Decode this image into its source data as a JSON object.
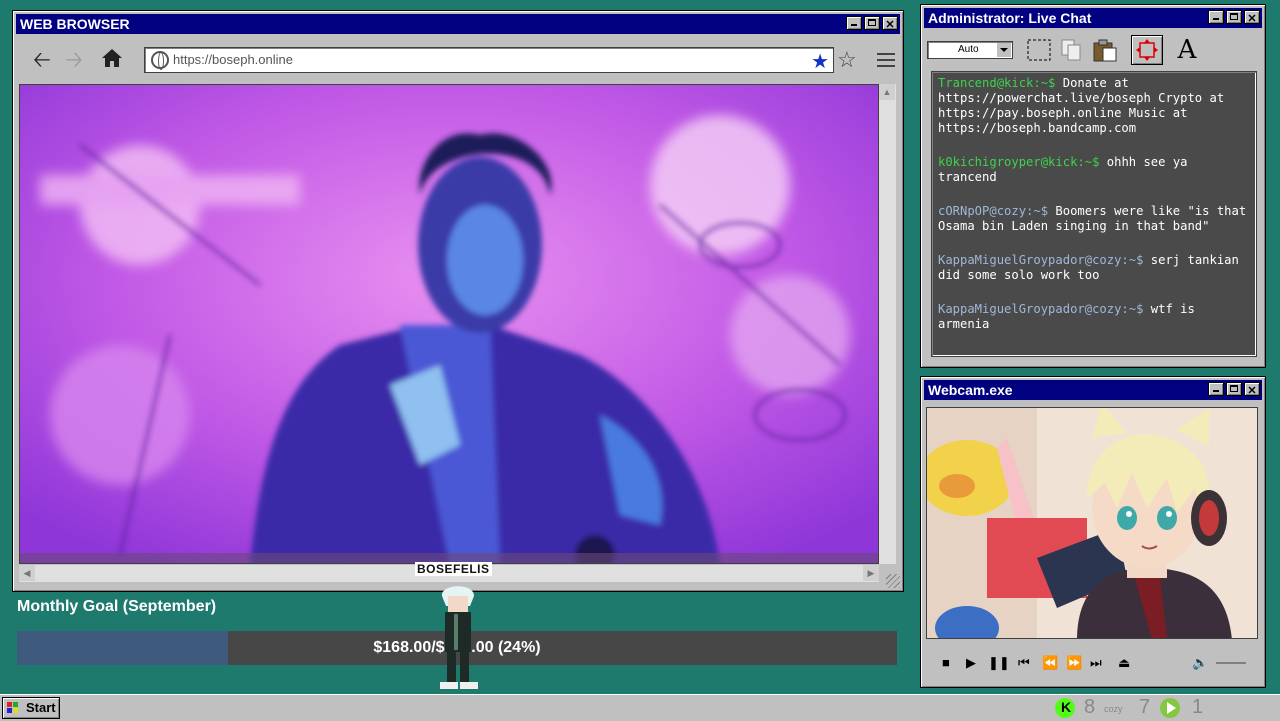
{
  "browser": {
    "title": "WEB BROWSER",
    "url": "https://boseph.online",
    "icons": [
      "back-arrow-icon",
      "forward-arrow-icon",
      "home-icon",
      "globe-icon",
      "bookmark-star-icon",
      "favorite-star-icon",
      "hamburger-menu-icon"
    ]
  },
  "chat": {
    "title": "Administrator: Live Chat",
    "zoom": "Auto",
    "tools": [
      "select-marquee-icon",
      "copy-icon",
      "paste-icon",
      "move-icon",
      "font-icon"
    ],
    "messages": [
      {
        "user": "Trancend@kick:~$",
        "text": "Donate at https://powerchat.live/boseph Crypto at https://pay.boseph.online Music at https://boseph.bandcamp.com",
        "platform": "kick"
      },
      {
        "user": "k0kichigroyper@kick:~$",
        "text": "ohhh see ya trancend",
        "platform": "kick"
      },
      {
        "user": "cORNpOP@cozy:~$",
        "text": "Boomers were like \"is that Osama bin Laden singing in that band\"",
        "platform": "cozy"
      },
      {
        "user": "KappaMiguelGroypador@cozy:~$",
        "text": "serj tankian did some solo work too",
        "platform": "cozy"
      },
      {
        "user": "KappaMiguelGroypador@cozy:~$",
        "text": "wtf is armenia",
        "platform": "cozy"
      }
    ]
  },
  "webcam": {
    "title": "Webcam.exe"
  },
  "goal": {
    "label": "Monthly Goal (September)",
    "text": "$168.00/$700.00 (24%)",
    "progress": 0.24,
    "fill_color": "#3e5a7d"
  },
  "sprite": {
    "label": "BOSEFELIS"
  },
  "taskbar": {
    "start": "Start",
    "kick_count": "8",
    "cozy_count": "7",
    "rumble_count": "1",
    "kick_color": "#53fc18",
    "rumble_color": "#85c742"
  }
}
